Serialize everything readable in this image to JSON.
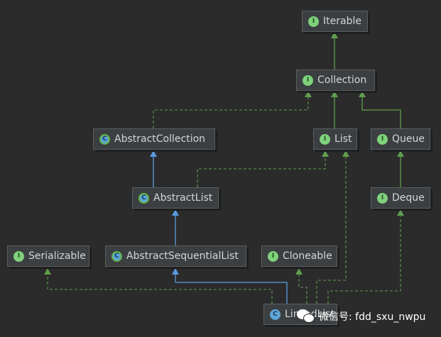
{
  "diagram": {
    "nodes": {
      "iterable": {
        "label": "Iterable",
        "kind": "interface",
        "badge": "I"
      },
      "collection": {
        "label": "Collection",
        "kind": "interface",
        "badge": "I"
      },
      "abstract_collection": {
        "label": "AbstractCollection",
        "kind": "abstract-class",
        "badge": "C"
      },
      "list": {
        "label": "List",
        "kind": "interface",
        "badge": "I"
      },
      "queue": {
        "label": "Queue",
        "kind": "interface",
        "badge": "I"
      },
      "abstract_list": {
        "label": "AbstractList",
        "kind": "abstract-class",
        "badge": "C"
      },
      "deque": {
        "label": "Deque",
        "kind": "interface",
        "badge": "I"
      },
      "serializable": {
        "label": "Serializable",
        "kind": "interface",
        "badge": "I"
      },
      "abstract_sequential_list": {
        "label": "AbstractSequentialList",
        "kind": "abstract-class",
        "badge": "C"
      },
      "cloneable": {
        "label": "Cloneable",
        "kind": "interface",
        "badge": "I"
      },
      "linked_list": {
        "label": "LinkedList",
        "kind": "class",
        "badge": "C"
      }
    },
    "colors": {
      "background": "#2b2b2b",
      "extends_edge": "#5a9ae0",
      "implements_edge": "#5f9e4f",
      "interface_badge": "#7fd27b",
      "class_badge": "#5fa5d8"
    }
  },
  "watermark": {
    "text": "微信号: fdd_sxu_nwpu",
    "icon": "wechat-icon"
  }
}
